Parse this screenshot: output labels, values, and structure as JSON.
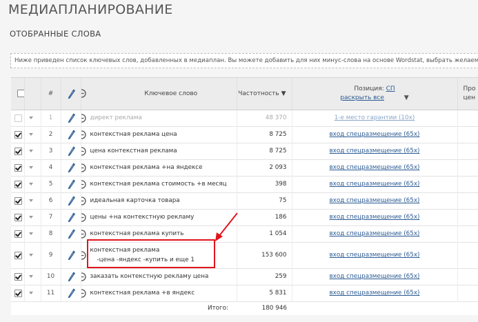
{
  "page_title": "МЕДИАПЛАНИРОВАНИЕ",
  "section_title": "ОТОБРАННЫЕ СЛОВА",
  "info_text": "Ниже приведен список ключевых слов, добавленных в медиаплан. Вы можете добавить для них минус-слова на основе Wordstat, выбрать желаемую позицию",
  "columns": {
    "num": "#",
    "keyword": "Ключевое слово",
    "frequency": "Частотность ▼",
    "position_label": "Позиция:",
    "position_link": "СП",
    "expand_all": "раскрыть все",
    "extra": "Про",
    "extra2": "цен"
  },
  "rows": [
    {
      "num": "1",
      "keyword": "директ реклама",
      "minus": "",
      "frequency": "48 370",
      "position": "1-е место гарантии (10х)",
      "checked": false,
      "disabled": true
    },
    {
      "num": "2",
      "keyword": "контекстная реклама цена",
      "minus": "",
      "frequency": "8 725",
      "position": "вход спецразмещение (65х)",
      "checked": true,
      "disabled": false
    },
    {
      "num": "3",
      "keyword": "цена контекстная реклама",
      "minus": "",
      "frequency": "8 725",
      "position": "вход спецразмещение (65х)",
      "checked": true,
      "disabled": false
    },
    {
      "num": "4",
      "keyword": "контекстная реклама +на яндексе",
      "minus": "",
      "frequency": "2 093",
      "position": "вход спецразмещение (65х)",
      "checked": true,
      "disabled": false
    },
    {
      "num": "5",
      "keyword": "контекстная реклама стоимость +в месяц",
      "minus": "",
      "frequency": "398",
      "position": "вход спецразмещение (65х)",
      "checked": true,
      "disabled": false
    },
    {
      "num": "6",
      "keyword": "идеальная карточка товара",
      "minus": "",
      "frequency": "75",
      "position": "вход спецразмещение (65х)",
      "checked": true,
      "disabled": false
    },
    {
      "num": "7",
      "keyword": "цены +на контекстную рекламу",
      "minus": "",
      "frequency": "186",
      "position": "вход спецразмещение (65х)",
      "checked": true,
      "disabled": false
    },
    {
      "num": "8",
      "keyword": "контекстная реклама купить",
      "minus": "",
      "frequency": "1 054",
      "position": "вход спецразмещение (65х)",
      "checked": true,
      "disabled": false
    },
    {
      "num": "9",
      "keyword": "контекстная реклама",
      "minus": "-цена -яндекс -купить и еще 1",
      "frequency": "153 600",
      "position": "вход спецразмещение (65х)",
      "checked": true,
      "disabled": false
    },
    {
      "num": "10",
      "keyword": "заказать контекстную рекламу цена",
      "minus": "",
      "frequency": "259",
      "position": "вход спецразмещение (65х)",
      "checked": true,
      "disabled": false
    },
    {
      "num": "11",
      "keyword": "контекстная реклама +в яндекс",
      "minus": "",
      "frequency": "5 831",
      "position": "вход спецразмещение (65х)",
      "checked": true,
      "disabled": false
    }
  ],
  "total_label": "Итого:",
  "total_value": "180 946",
  "colors": {
    "link": "#2b5a93",
    "highlight": "#e0141c",
    "header_bg": "#ececec"
  }
}
